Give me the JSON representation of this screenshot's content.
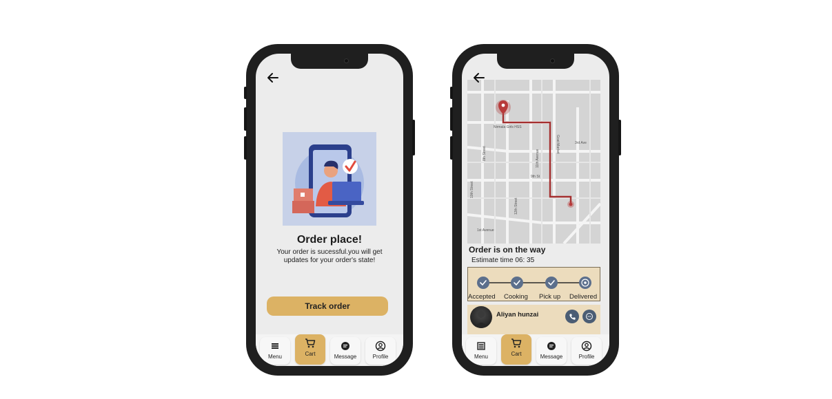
{
  "left_screen": {
    "title": "Order place!",
    "description": "Your order is sucessful.you will get updates for your order's state!",
    "track_button": "Track order"
  },
  "right_screen": {
    "status_title": "Order is on the way",
    "estimate": "Estimate time 06: 35",
    "map_labels": [
      "8th Street",
      "Nirmala Girls HSS",
      "11th Avenue",
      "3rd Ave",
      "9th St",
      "10th Street",
      "12th Street",
      "1st Avenue",
      "Goat Market"
    ],
    "steps": [
      {
        "label": "Accepted",
        "done": true
      },
      {
        "label": "Cooking",
        "done": true
      },
      {
        "label": "Pick up",
        "done": true
      },
      {
        "label": "Delivered",
        "done": false
      }
    ],
    "driver_name": "Aliyan hunzai"
  },
  "nav": {
    "items": [
      {
        "label": "Menu",
        "icon": "menu-icon"
      },
      {
        "label": "Cart",
        "icon": "cart-icon",
        "active": true
      },
      {
        "label": "Message",
        "icon": "message-icon"
      },
      {
        "label": "Profile",
        "icon": "profile-icon"
      }
    ]
  },
  "colors": {
    "accent": "#dcb264",
    "route": "#a42f2f",
    "step_blue": "#5c6f8c",
    "panel": "#ecdcbd"
  }
}
